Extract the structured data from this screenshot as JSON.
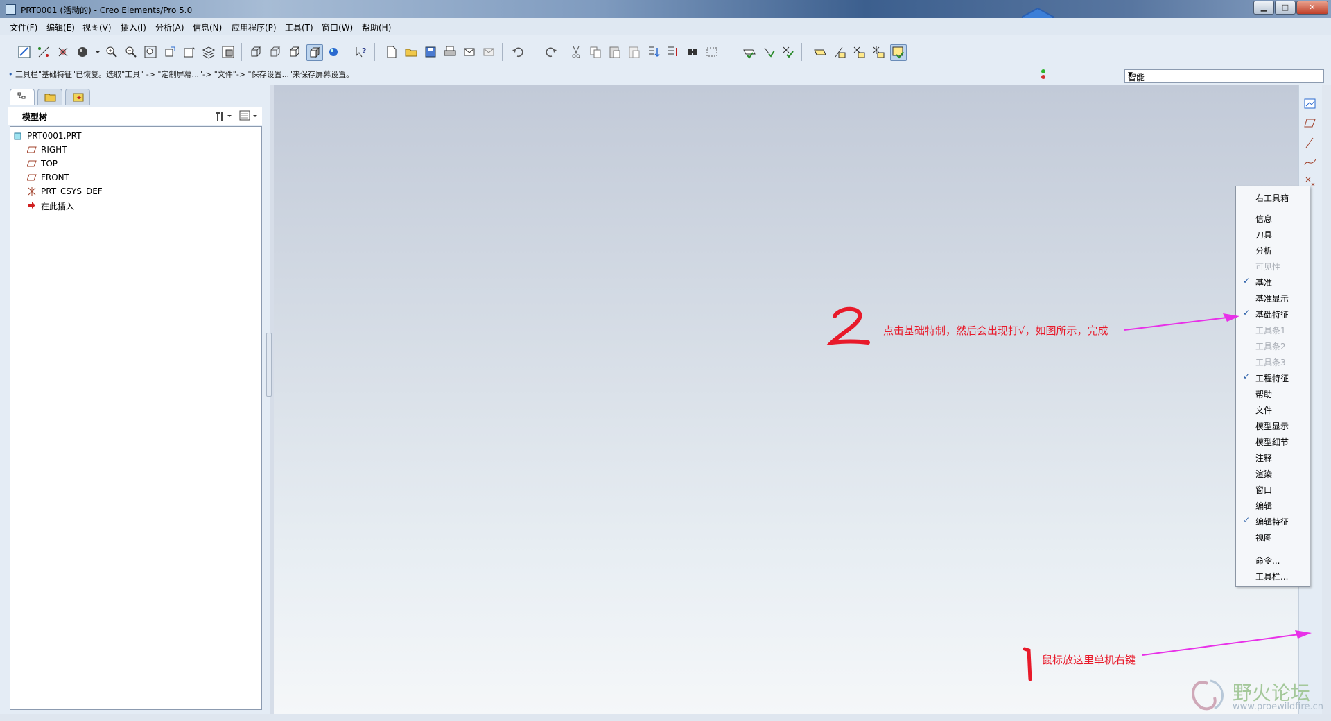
{
  "window": {
    "title": "PRT0001 (活动的) - Creo Elements/Pro 5.0",
    "controls": [
      "minimize",
      "maximize",
      "close"
    ]
  },
  "menubar": {
    "items": [
      "文件(F)",
      "编辑(E)",
      "视图(V)",
      "插入(I)",
      "分析(A)",
      "信息(N)",
      "应用程序(P)",
      "工具(T)",
      "窗口(W)",
      "帮助(H)"
    ]
  },
  "toolbar": {
    "icons": [
      "sketch-icon",
      "datum-axis-icon",
      "datum-point-icon",
      "shade-sphere-icon",
      "dropdown-icon",
      "zoom-in-icon",
      "zoom-out-icon",
      "refit-icon",
      "reorient-icon",
      "saved-view-icon",
      "layer-icon",
      "view-manager-icon",
      "wireframe-icon",
      "hidden-line-icon",
      "no-hidden-icon",
      "shading-icon",
      "appearance-icon",
      "whats-this-icon",
      "new-file-icon",
      "open-file-icon",
      "save-icon",
      "print-icon",
      "email-icon",
      "email-link-icon",
      "undo-icon",
      "redo-icon",
      "cut-icon",
      "copy-icon",
      "paste-icon",
      "paste-special-icon",
      "regenerate-icon",
      "regen-manager-icon",
      "find-icon",
      "selection-box-icon",
      "datum-plane-toggle-icon",
      "datum-axis-toggle-icon",
      "datum-point-toggle-icon",
      "csys-toggle-icon",
      "plane-display-icon",
      "axis-display-icon",
      "point-display-icon",
      "csys-display-icon",
      "annotation-display-icon"
    ]
  },
  "status": {
    "message": "工具栏\"基础特征\"已恢复。选取\"工具\" -> \"定制屏幕...\"-> \"文件\"-> \"保存设置...\"来保存屏幕设置。",
    "filter_value": "智能",
    "light_colors": {
      "green": "#2db52d",
      "red": "#d23030"
    }
  },
  "navigator": {
    "tabs": [
      "model-tree-tab",
      "folder-browser-tab",
      "favorites-tab"
    ],
    "header_label": "模型树",
    "tree": [
      {
        "label": "PRT0001.PRT",
        "icon": "part-icon",
        "level": 0
      },
      {
        "label": "RIGHT",
        "icon": "datum-plane-icon",
        "level": 1
      },
      {
        "label": "TOP",
        "icon": "datum-plane-icon",
        "level": 1
      },
      {
        "label": "FRONT",
        "icon": "datum-plane-icon",
        "level": 1
      },
      {
        "label": "PRT_CSYS_DEF",
        "icon": "csys-icon",
        "level": 1
      },
      {
        "label": "在此插入",
        "icon": "insert-here-icon",
        "level": 1
      }
    ]
  },
  "context_menu": {
    "header": "右工具箱",
    "items": [
      {
        "label": "信息",
        "checked": false,
        "enabled": true
      },
      {
        "label": "刀具",
        "checked": false,
        "enabled": true
      },
      {
        "label": "分析",
        "checked": false,
        "enabled": true
      },
      {
        "label": "可见性",
        "checked": false,
        "enabled": false
      },
      {
        "label": "基准",
        "checked": true,
        "enabled": true
      },
      {
        "label": "基准显示",
        "checked": false,
        "enabled": true
      },
      {
        "label": "基础特征",
        "checked": true,
        "enabled": true
      },
      {
        "label": "工具条1",
        "checked": false,
        "enabled": false
      },
      {
        "label": "工具条2",
        "checked": false,
        "enabled": false
      },
      {
        "label": "工具条3",
        "checked": false,
        "enabled": false
      },
      {
        "label": "工程特征",
        "checked": true,
        "enabled": true
      },
      {
        "label": "帮助",
        "checked": false,
        "enabled": true
      },
      {
        "label": "文件",
        "checked": false,
        "enabled": true
      },
      {
        "label": "模型显示",
        "checked": false,
        "enabled": true
      },
      {
        "label": "模型细节",
        "checked": false,
        "enabled": true
      },
      {
        "label": "注释",
        "checked": false,
        "enabled": true
      },
      {
        "label": "渲染",
        "checked": false,
        "enabled": true
      },
      {
        "label": "窗口",
        "checked": false,
        "enabled": true
      },
      {
        "label": "编辑",
        "checked": false,
        "enabled": true
      },
      {
        "label": "编辑特征",
        "checked": true,
        "enabled": true
      },
      {
        "label": "视图",
        "checked": false,
        "enabled": true
      }
    ],
    "footer": [
      "命令...",
      "工具栏..."
    ],
    "check_mark": "✓"
  },
  "annotations": {
    "step2_number": "2",
    "step2_text": "点击基础特制，然后会出现打√，如图所示，完成",
    "step1_number": "1",
    "step1_text": "鼠标放这里单机右键",
    "color": "#e81a2a",
    "arrow_color": "#e830e8"
  },
  "watermark": {
    "title": "野火论坛",
    "url": "www.proewildfire.cn"
  }
}
